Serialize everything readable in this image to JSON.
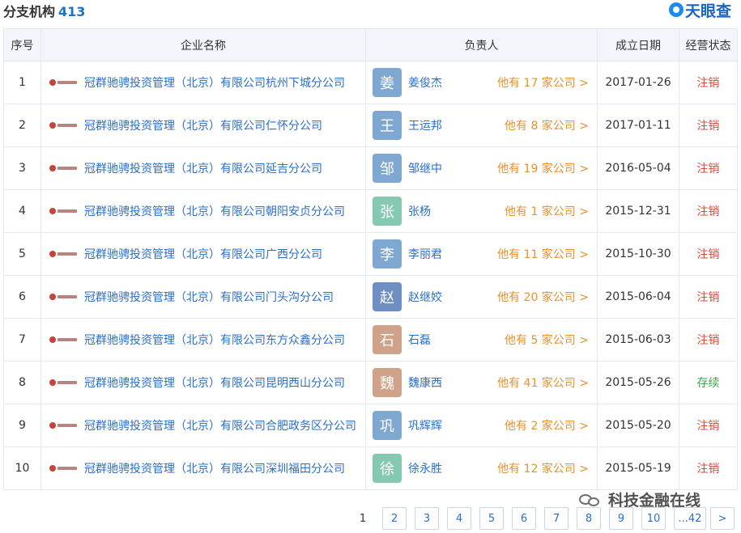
{
  "header": {
    "title": "分支机构",
    "count": "413",
    "logo_text": "天眼查"
  },
  "table": {
    "columns": [
      "序号",
      "企业名称",
      "负责人",
      "成立日期",
      "经营状态"
    ],
    "rows": [
      {
        "idx": "1",
        "company": "冠群驰骋投资管理（北京）有限公司杭州下城分公司",
        "avatar": "姜",
        "avatar_color": "#7ea7d2",
        "owner": "姜俊杰",
        "more": "他有 17 家公司 >",
        "date": "2017-01-26",
        "status": "注销",
        "status_color": "#e0493a"
      },
      {
        "idx": "2",
        "company": "冠群驰骋投资管理（北京）有限公司仁怀分公司",
        "avatar": "王",
        "avatar_color": "#7ea7d2",
        "owner": "王运邦",
        "more": "他有 8 家公司 >",
        "date": "2017-01-11",
        "status": "注销",
        "status_color": "#e0493a"
      },
      {
        "idx": "3",
        "company": "冠群驰骋投资管理（北京）有限公司延吉分公司",
        "avatar": "邹",
        "avatar_color": "#7ea7d2",
        "owner": "邹继中",
        "more": "他有 19 家公司 >",
        "date": "2016-05-04",
        "status": "注销",
        "status_color": "#e0493a"
      },
      {
        "idx": "4",
        "company": "冠群驰骋投资管理（北京）有限公司朝阳安贞分公司",
        "avatar": "张",
        "avatar_color": "#86c9b3",
        "owner": "张杨",
        "more": "他有 1 家公司 >",
        "date": "2015-12-31",
        "status": "注销",
        "status_color": "#e0493a"
      },
      {
        "idx": "5",
        "company": "冠群驰骋投资管理（北京）有限公司广西分公司",
        "avatar": "李",
        "avatar_color": "#7ea7d2",
        "owner": "李丽君",
        "more": "他有 11 家公司 >",
        "date": "2015-10-30",
        "status": "注销",
        "status_color": "#e0493a"
      },
      {
        "idx": "6",
        "company": "冠群驰骋投资管理（北京）有限公司门头沟分公司",
        "avatar": "赵",
        "avatar_color": "#6e8fc4",
        "owner": "赵继姣",
        "more": "他有 20 家公司 >",
        "date": "2015-06-04",
        "status": "注销",
        "status_color": "#e0493a"
      },
      {
        "idx": "7",
        "company": "冠群驰骋投资管理（北京）有限公司东方众鑫分公司",
        "avatar": "石",
        "avatar_color": "#cfa28a",
        "owner": "石磊",
        "more": "他有 5 家公司 >",
        "date": "2015-06-03",
        "status": "注销",
        "status_color": "#e0493a"
      },
      {
        "idx": "8",
        "company": "冠群驰骋投资管理（北京）有限公司昆明西山分公司",
        "avatar": "魏",
        "avatar_color": "#cfa28a",
        "owner": "魏康西",
        "more": "他有 41 家公司 >",
        "date": "2015-05-26",
        "status": "存续",
        "status_color": "#3aa64c"
      },
      {
        "idx": "9",
        "company": "冠群驰骋投资管理（北京）有限公司合肥政务区分公司",
        "avatar": "巩",
        "avatar_color": "#7ea7d2",
        "owner": "巩辉辉",
        "more": "他有 2 家公司 >",
        "date": "2015-05-20",
        "status": "注销",
        "status_color": "#e0493a"
      },
      {
        "idx": "10",
        "company": "冠群驰骋投资管理（北京）有限公司深圳福田分公司",
        "avatar": "徐",
        "avatar_color": "#86c9b3",
        "owner": "徐永胜",
        "more": "他有 12 家公司 >",
        "date": "2015-05-19",
        "status": "注销",
        "status_color": "#e0493a"
      }
    ]
  },
  "pagination": {
    "current": "1",
    "pages": [
      "2",
      "3",
      "4",
      "5",
      "6",
      "7",
      "8",
      "9",
      "10",
      "...42"
    ],
    "next": ">"
  },
  "watermark": "科技金融在线",
  "colors": {
    "link": "#2a6fc9",
    "orange": "#e8912f",
    "header_bg": "#f2f6fb",
    "border": "#e4eaf2"
  }
}
